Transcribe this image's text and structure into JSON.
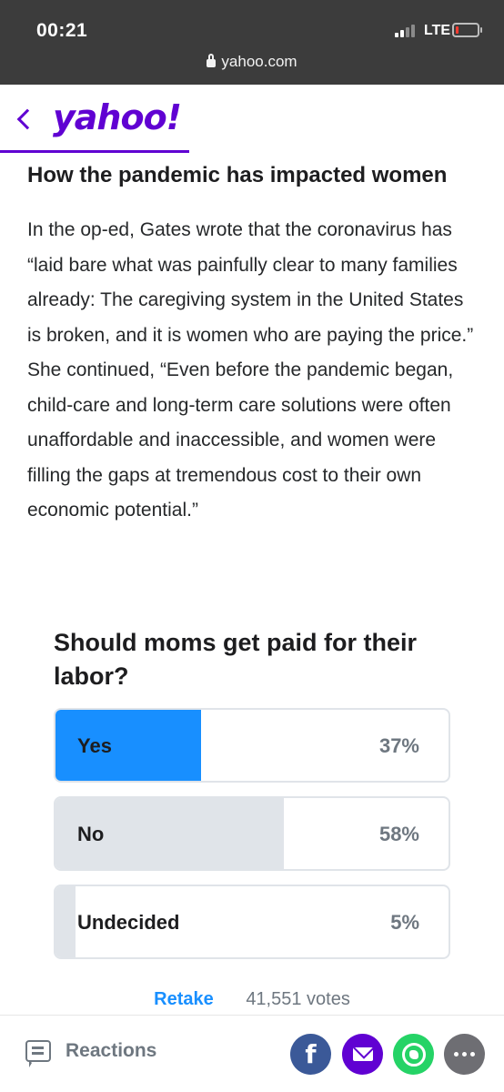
{
  "status_bar": {
    "time": "00:21",
    "network": "LTE"
  },
  "browser": {
    "url": "yahoo.com"
  },
  "header": {
    "logo": "yahoo!"
  },
  "article": {
    "heading": "How the pandemic has impacted women",
    "paragraph": "In the op-ed, Gates wrote that the coronavirus has “laid bare what was painfully clear to many families already: The caregiving system in the United States is broken, and it is women who are paying the price.” She continued, “Even before the pandemic began, child-care and long-term care solutions were often unaffordable and inaccessible, and women were filling the gaps at tremendous cost to their own economic potential.”"
  },
  "poll": {
    "question": "Should moms get paid for their labor?",
    "options": [
      {
        "label": "Yes",
        "percent_text": "37%",
        "percent": 37,
        "selected": true
      },
      {
        "label": "No",
        "percent_text": "58%",
        "percent": 58,
        "selected": false
      },
      {
        "label": "Undecided",
        "percent_text": "5%",
        "percent": 5,
        "selected": false
      }
    ],
    "retake_label": "Retake",
    "votes_text": "41,551 votes"
  },
  "bottom_bar": {
    "reactions_label": "Reactions",
    "share_buttons": [
      "facebook-icon",
      "mail-icon",
      "whatsapp-icon",
      "more-icon"
    ],
    "facebook_glyph": "f"
  },
  "colors": {
    "brand": "#6001d2",
    "poll_selected": "#188fff",
    "poll_fill": "#e0e4e9",
    "facebook": "#3b5998",
    "whatsapp": "#25d366"
  }
}
